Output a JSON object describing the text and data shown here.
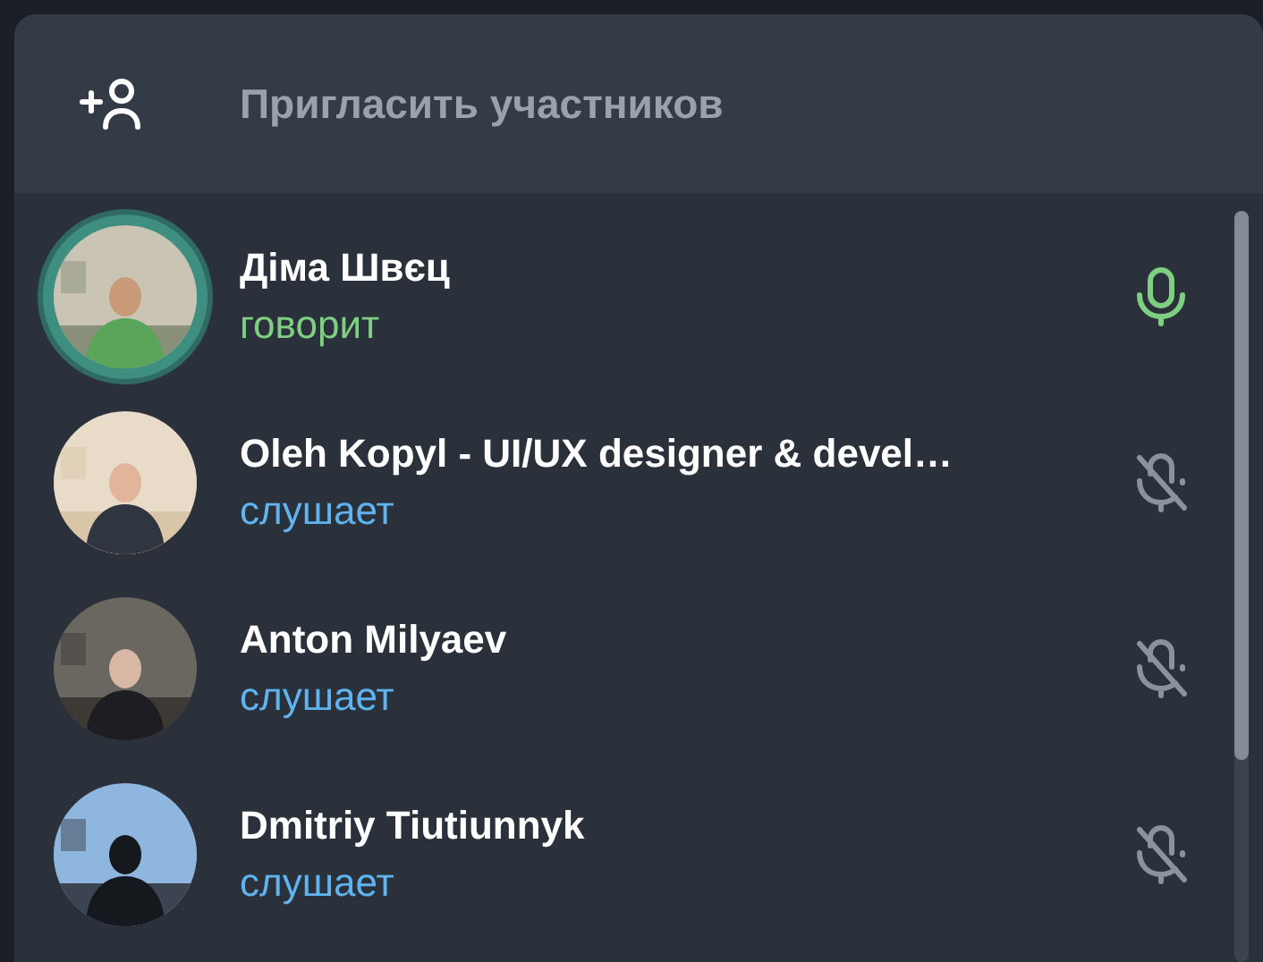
{
  "invite": {
    "label": "Пригласить участников"
  },
  "participants": [
    {
      "name": "Діма Швєц",
      "status": "говорит",
      "speaking": true
    },
    {
      "name": "Oleh Kopyl - UI/UX designer & devel…",
      "status": "слушает",
      "speaking": false
    },
    {
      "name": "Anton Milyaev",
      "status": "слушает",
      "speaking": false
    },
    {
      "name": "Dmitriy Tiutiunnyk",
      "status": "слушает",
      "speaking": false
    }
  ]
}
